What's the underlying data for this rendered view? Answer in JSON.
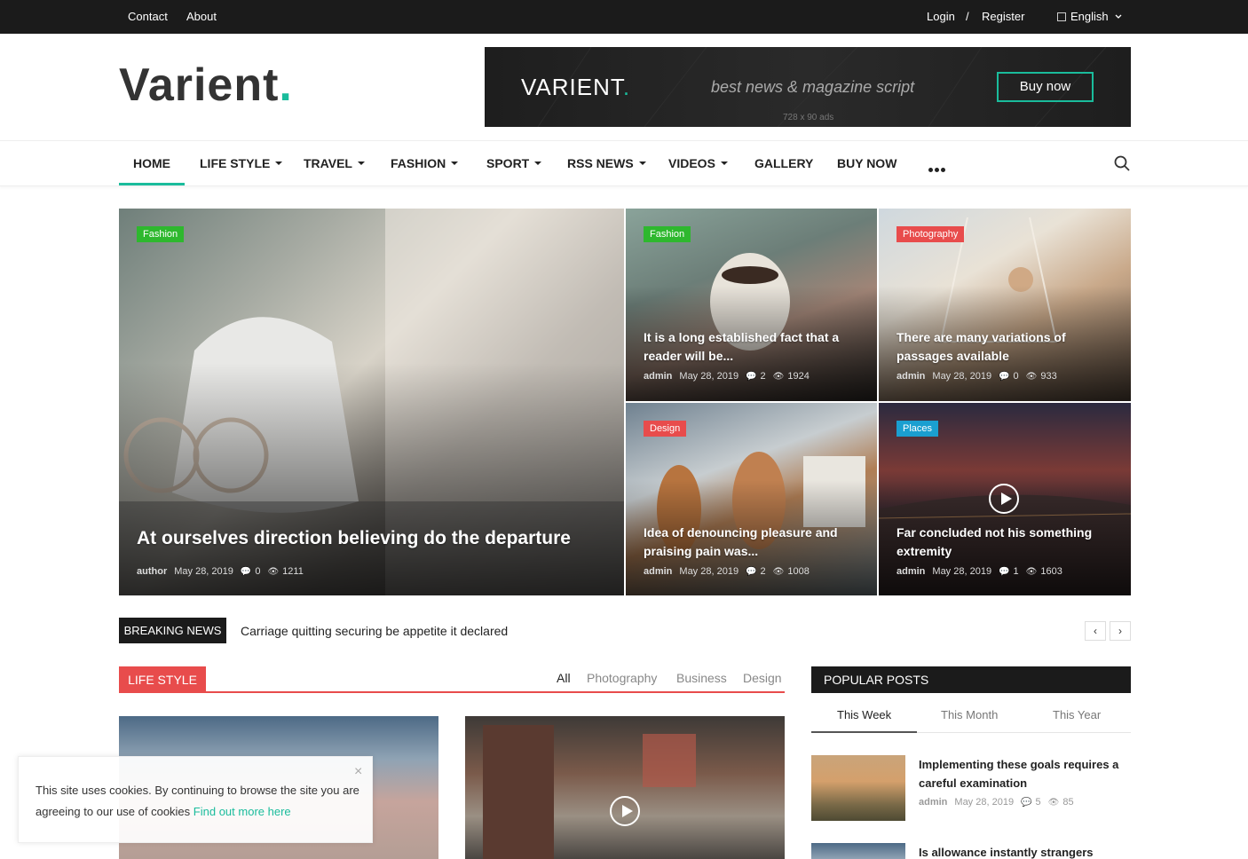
{
  "topbar": {
    "contact": "Contact",
    "about": "About",
    "login": "Login",
    "separator": "/",
    "register": "Register",
    "language": "English"
  },
  "logo": {
    "text": "Varient",
    "dot": "."
  },
  "ad": {
    "logo": "VARIENT",
    "dot": ".",
    "tagline": "best news & magazine script",
    "button": "Buy now",
    "size": "728 x 90 ads"
  },
  "nav": {
    "items": [
      "HOME",
      "LIFE STYLE",
      "TRAVEL",
      "FASHION",
      "SPORT",
      "RSS NEWS",
      "VIDEOS",
      "GALLERY",
      "BUY NOW"
    ]
  },
  "featured": [
    {
      "category": "Fashion",
      "category_color": "#2eb82e",
      "title": "At ourselves direction believing do the departure",
      "author": "author",
      "date": "May 28, 2019",
      "comments": "0",
      "views": "1211"
    },
    {
      "category": "Fashion",
      "category_color": "#2eb82e",
      "title": "It is a long established fact that a reader will be...",
      "author": "admin",
      "date": "May 28, 2019",
      "comments": "2",
      "views": "1924"
    },
    {
      "category": "Photography",
      "category_color": "#e84c4c",
      "title": "There are many variations of passages available",
      "author": "admin",
      "date": "May 28, 2019",
      "comments": "0",
      "views": "933"
    },
    {
      "category": "Design",
      "category_color": "#e84c4c",
      "title": "Idea of denouncing pleasure and praising pain was...",
      "author": "admin",
      "date": "May 28, 2019",
      "comments": "2",
      "views": "1008"
    },
    {
      "category": "Places",
      "category_color": "#1a9fd0",
      "title": "Far concluded not his something extremity",
      "author": "admin",
      "date": "May 28, 2019",
      "comments": "1",
      "views": "1603"
    }
  ],
  "breaking": {
    "label": "BREAKING NEWS",
    "text": "Carriage quitting securing be appetite it declared",
    "prev": "‹",
    "next": "›"
  },
  "lifestyle": {
    "label": "LIFE STYLE",
    "filters": [
      "All",
      "Photography",
      "Business",
      "Design"
    ]
  },
  "popular": {
    "label": "POPULAR POSTS",
    "tabs": [
      "This Week",
      "This Month",
      "This Year"
    ],
    "posts": [
      {
        "title": "Implementing these goals requires a careful examination",
        "author": "admin",
        "date": "May 28, 2019",
        "comments": "5",
        "views": "85"
      },
      {
        "title": "Is allowance instantly strangers"
      }
    ]
  },
  "cookie": {
    "text": "This site uses cookies. By continuing to browse the site you are agreeing to our use of cookies",
    "link": "Find out more here",
    "close": "×"
  },
  "colors": {
    "accent": "#1abc9c",
    "topbar": "#1b1b1b",
    "section": "#e84c4c"
  }
}
